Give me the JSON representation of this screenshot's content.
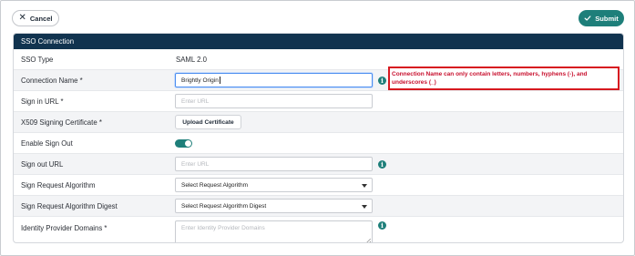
{
  "toolbar": {
    "cancel_label": "Cancel",
    "submit_label": "Submit"
  },
  "colors": {
    "accent": "#1e7f7a",
    "header_bg": "#11334f",
    "error": "#c8102e"
  },
  "section": {
    "title": "SSO Connection"
  },
  "fields": {
    "sso_type": {
      "label": "SSO Type",
      "value": "SAML 2.0"
    },
    "connection_name": {
      "label": "Connection Name *",
      "value": "Brightly Origin"
    },
    "sign_in_url": {
      "label": "Sign in URL *",
      "placeholder": "Enter URL"
    },
    "x509_cert": {
      "label": "X509 Signing Certificate *",
      "button_label": "Upload Certificate"
    },
    "enable_sign_out": {
      "label": "Enable Sign Out",
      "state": "on"
    },
    "sign_out_url": {
      "label": "Sign out URL",
      "placeholder": "Enter URL"
    },
    "sign_request_algorithm": {
      "label": "Sign Request Algorithm",
      "selected": "Select Request Algorithm"
    },
    "sign_request_algorithm_digest": {
      "label": "Sign Request Algorithm Digest",
      "selected": "Select Request Algorithm Digest"
    },
    "identity_provider_domains": {
      "label": "Identity Provider Domains *",
      "placeholder": "Enter Identity Provider Domains"
    }
  },
  "error": {
    "message": "Connection Name can only contain letters, numbers, hyphens (-), and underscores (_)"
  },
  "icons": {
    "cancel": "close-icon",
    "submit": "check-icon",
    "info": "info-icon",
    "dropdown": "chevron-down-icon"
  }
}
